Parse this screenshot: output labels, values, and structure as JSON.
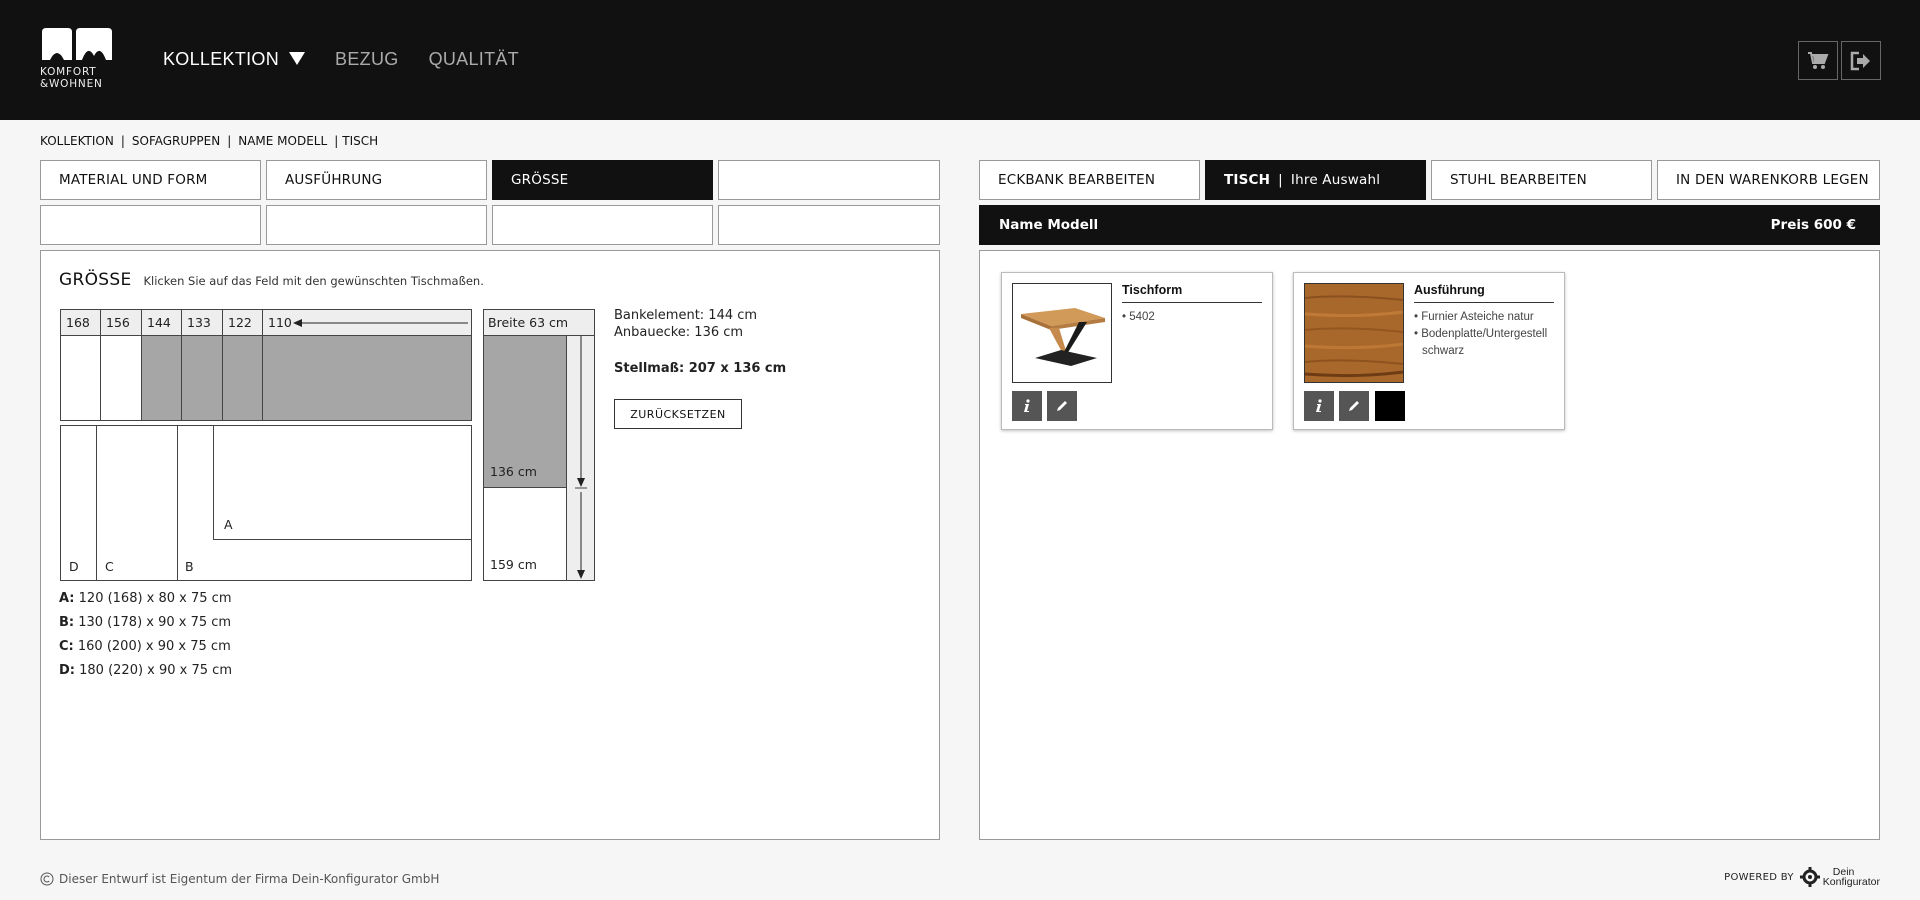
{
  "brand": {
    "line1": "KOMFORT",
    "line2": "&WOHNEN"
  },
  "nav": {
    "items": [
      {
        "label": "KOLLEKTION"
      },
      {
        "label": "BEZUG"
      },
      {
        "label": "QUALITÄT"
      }
    ]
  },
  "header_buttons": {
    "cart": "cart-icon",
    "logout": "logout-icon"
  },
  "breadcrumb": {
    "items": [
      "KOLLEKTION",
      "SOFAGRUPPEN",
      "NAME MODELL",
      "TISCH"
    ]
  },
  "left_tabs": {
    "row1": [
      "MATERIAL UND FORM",
      "AUSFÜHRUNG",
      "GRÖSSE",
      ""
    ],
    "row2": [
      "",
      "",
      "",
      ""
    ]
  },
  "size": {
    "title": "GRÖSSE",
    "hint": "Klicken Sie auf das Feld mit den gewünschten Tischmaßen.",
    "length_labels": [
      "168",
      "156",
      "144",
      "133",
      "122",
      "110"
    ],
    "width_label": "Breite 63 cm",
    "depth_136": "136 cm",
    "depth_159": "159 cm",
    "zones": [
      "A",
      "B",
      "C",
      "D"
    ],
    "bankelement": "Bankelement: 144 cm",
    "anbauecke": "Anbauecke: 136 cm",
    "stellmass": "Stellmaß: 207 x 136 cm",
    "reset_label": "ZURÜCKSETZEN",
    "legend": [
      {
        "key": "A:",
        "value": " 120 (168) x 80 x 75 cm"
      },
      {
        "key": "B:",
        "value": " 130 (178) x 90 x 75 cm"
      },
      {
        "key": "C:",
        "value": " 160 (200) x 90 x 75 cm"
      },
      {
        "key": "D:",
        "value": " 180 (220) x 90 x 75 cm"
      }
    ]
  },
  "right_tabs": [
    {
      "label": "ECKBANK BEARBEITEN"
    },
    {
      "label": "TISCH",
      "sub": "Ihre Auswahl"
    },
    {
      "label": "STUHL BEARBEITEN"
    },
    {
      "label": "IN DEN WARENKORB LEGEN"
    }
  ],
  "model_bar": {
    "name": "Name Modell",
    "price": "Preis 600 €"
  },
  "cards": [
    {
      "title": "Tischform",
      "items": [
        "• 5402"
      ]
    },
    {
      "title": "Ausführung",
      "items": [
        "• Furnier Asteiche natur",
        "• Bodenplatte/Untergestell schwarz"
      ],
      "swatch": "#000000"
    }
  ],
  "footer": {
    "copyright": "Dieser Entwurf ist Eigentum der Firma Dein-Konfigurator GmbH",
    "powered_by": "POWERED BY",
    "logo_line1": "Dein",
    "logo_line2": "Konfigurator"
  },
  "colors": {
    "header_bg": "#111111",
    "selected_cell": "#a6a6a6",
    "button_grey": "#555555"
  }
}
